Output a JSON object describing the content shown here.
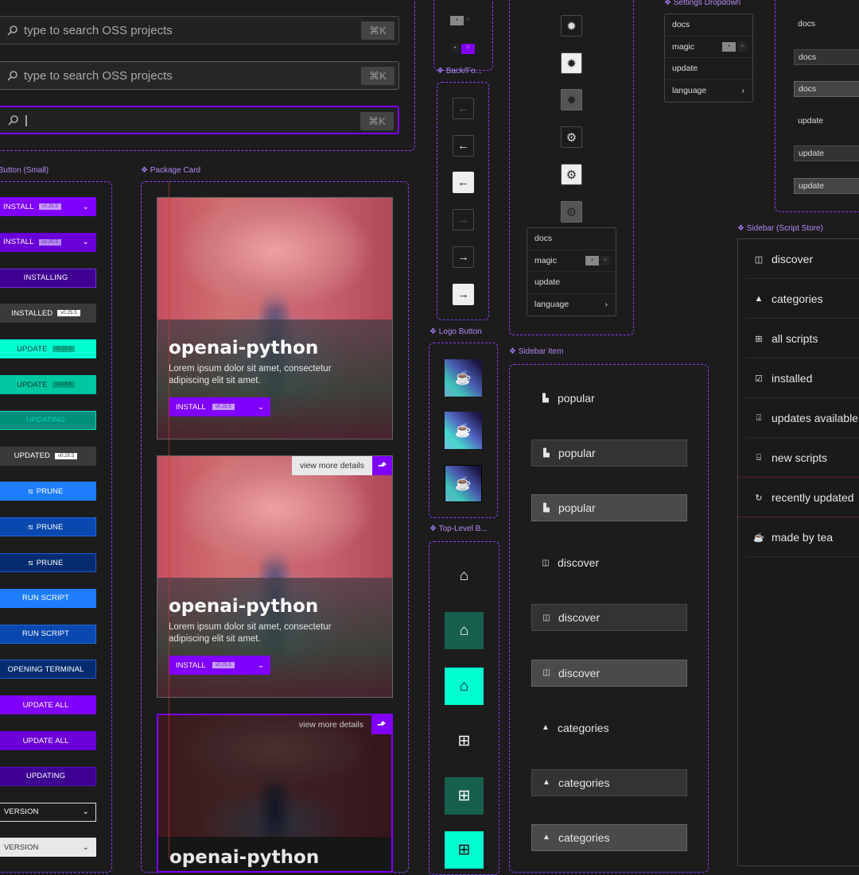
{
  "search": {
    "placeholder": "type to search OSS projects",
    "shortcut": "⌘K",
    "focused_value": "|"
  },
  "labels": {
    "button_small": "Button (Small)",
    "package_card": "Package Card",
    "back_forward": "Back/Fo...",
    "logo_button": "Logo Button",
    "top_level": "Top-Level B...",
    "sidebar_item": "Sidebar Item",
    "settings_dropdown": "Settings Dropdown",
    "sidebar_script_store": "Sidebar (Script Store)"
  },
  "buttons": [
    {
      "label": "INSTALL",
      "version": "v0.25.5",
      "chevron": true,
      "bg": "#8000ff",
      "border": "#8000ff",
      "color": "#fff",
      "verbg": "#c89aff",
      "vercolor": "#7020d0"
    },
    {
      "label": "INSTALL",
      "version": "v0.25.5",
      "chevron": true,
      "bg": "#6a00d8",
      "border": "#6a00d8",
      "color": "#fff",
      "verbg": "#b88af0",
      "vercolor": "#6020c0"
    },
    {
      "label": "INSTALLING",
      "bg": "#3d0090",
      "border": "#7a2be0",
      "color": "#fff"
    },
    {
      "label": "INSTALLED",
      "version": "v0.25.5",
      "bg": "#3a3a3a",
      "border": "#3a3a3a",
      "color": "#fff",
      "verbg": "#fff",
      "vercolor": "#333"
    },
    {
      "label": "UPDATE",
      "version": "v0.25.5",
      "bg": "#00ffd0",
      "border": "#00ffd0",
      "color": "#0a3a30",
      "verbg": "#00b890",
      "vercolor": "#0a6a55"
    },
    {
      "label": "UPDATE",
      "version": "v0.25.5",
      "bg": "#00c8a0",
      "border": "#00c8a0",
      "color": "#0a3a30",
      "verbg": "#00a080",
      "vercolor": "#0a5a48"
    },
    {
      "label": "UPDATING",
      "bg": "#00907a",
      "border": "#00d8b0",
      "color": "#00d0b0"
    },
    {
      "label": "UPDATED",
      "version": "v0.25.5",
      "bg": "#3a3a3a",
      "border": "#3a3a3a",
      "color": "#fff",
      "verbg": "#fff",
      "vercolor": "#333"
    },
    {
      "label": "PRUNE",
      "icon": "prune-icon",
      "bg": "#1e7cff",
      "border": "#1e7cff",
      "color": "#fff"
    },
    {
      "label": "PRUNE",
      "icon": "prune-icon",
      "bg": "#0a48b0",
      "border": "#1e6ce0",
      "color": "#fff"
    },
    {
      "label": "PRUNE",
      "icon": "prune-icon",
      "bg": "#062c70",
      "border": "#1e5cd0",
      "color": "#fff"
    },
    {
      "label": "RUN SCRIPT",
      "bg": "#1e7cff",
      "border": "#1e7cff",
      "color": "#fff"
    },
    {
      "label": "RUN SCRIPT",
      "bg": "#0a48b0",
      "border": "#1e6ce0",
      "color": "#fff"
    },
    {
      "label": "OPENING TERMINAL",
      "bg": "#062c70",
      "border": "#1e5cd0",
      "color": "#fff"
    },
    {
      "label": "UPDATE ALL",
      "bg": "#8000ff",
      "border": "#8000ff",
      "color": "#fff"
    },
    {
      "label": "UPDATE ALL",
      "bg": "#6a00d8",
      "border": "#6a00d8",
      "color": "#fff"
    },
    {
      "label": "UPDATING",
      "bg": "#3d0090",
      "border": "#5a10c0",
      "color": "#fff"
    },
    {
      "label": "VERSION",
      "chevron": true,
      "left": true,
      "bg": "#1c1c1c",
      "border": "#ddd",
      "color": "#fff"
    },
    {
      "label": "VERSION",
      "chevron": true,
      "left": true,
      "bg": "#e8e8e8",
      "border": "#e8e8e8",
      "color": "#333"
    }
  ],
  "cards": [
    {
      "title": "openai-python",
      "description": "Lorem ipsum dolor sit amet, consectetur adipiscing elit sit amet.",
      "install_label": "INSTALL",
      "version": "v0.25.5"
    },
    {
      "title": "openai-python",
      "description": "Lorem ipsum dolor sit amet, consectetur adipiscing elit sit amet.",
      "install_label": "INSTALL",
      "version": "v0.25.5",
      "details_label": "view more details"
    },
    {
      "title": "openai-python",
      "details_label": "view more details"
    }
  ],
  "dropdown": {
    "items": [
      {
        "label": "docs"
      },
      {
        "label": "magic",
        "toggle": true
      },
      {
        "label": "update"
      },
      {
        "label": "language",
        "submenu": "›"
      }
    ]
  },
  "sidebar_items": [
    {
      "label": "popular",
      "icon": "chart-icon",
      "glyph": "▙",
      "state": "default"
    },
    {
      "label": "popular",
      "icon": "chart-icon",
      "glyph": "▙",
      "state": "hover"
    },
    {
      "label": "popular",
      "icon": "chart-icon",
      "glyph": "▙",
      "state": "active"
    },
    {
      "label": "discover",
      "icon": "map-icon",
      "glyph": "◫",
      "state": "default"
    },
    {
      "label": "discover",
      "icon": "map-icon",
      "glyph": "◫",
      "state": "hover"
    },
    {
      "label": "discover",
      "icon": "map-icon",
      "glyph": "◫",
      "state": "active"
    },
    {
      "label": "categories",
      "icon": "shapes-icon",
      "glyph": "▲",
      "state": "default"
    },
    {
      "label": "categories",
      "icon": "shapes-icon",
      "glyph": "▲",
      "state": "hover"
    },
    {
      "label": "categories",
      "icon": "shapes-icon",
      "glyph": "▲",
      "state": "active"
    }
  ],
  "right_items": [
    {
      "label": "docs",
      "state": "default"
    },
    {
      "label": "docs",
      "state": "hover"
    },
    {
      "label": "docs",
      "state": "active"
    },
    {
      "label": "update",
      "state": "default"
    },
    {
      "label": "update",
      "state": "hover"
    },
    {
      "label": "update",
      "state": "active"
    }
  ],
  "script_store": [
    {
      "label": "discover",
      "icon": "map-icon",
      "glyph": "◫"
    },
    {
      "label": "categories",
      "icon": "shapes-icon",
      "glyph": "▲"
    },
    {
      "label": "all scripts",
      "icon": "grid-icon",
      "glyph": "⊞"
    },
    {
      "label": "installed",
      "icon": "check-icon",
      "glyph": "☑"
    },
    {
      "label": "updates available",
      "icon": "download-icon",
      "glyph": "⍗"
    },
    {
      "label": "new scripts",
      "icon": "gift-icon",
      "glyph": "⌸"
    },
    {
      "label": "recently updated",
      "icon": "refresh-icon",
      "glyph": "↻"
    },
    {
      "label": "made by tea",
      "icon": "tea-icon",
      "glyph": "☕"
    }
  ],
  "colors": {
    "accent": "#8000ff",
    "teal": "#00ffd0",
    "blue": "#1e7cff",
    "frame": "#8a3ffc"
  }
}
